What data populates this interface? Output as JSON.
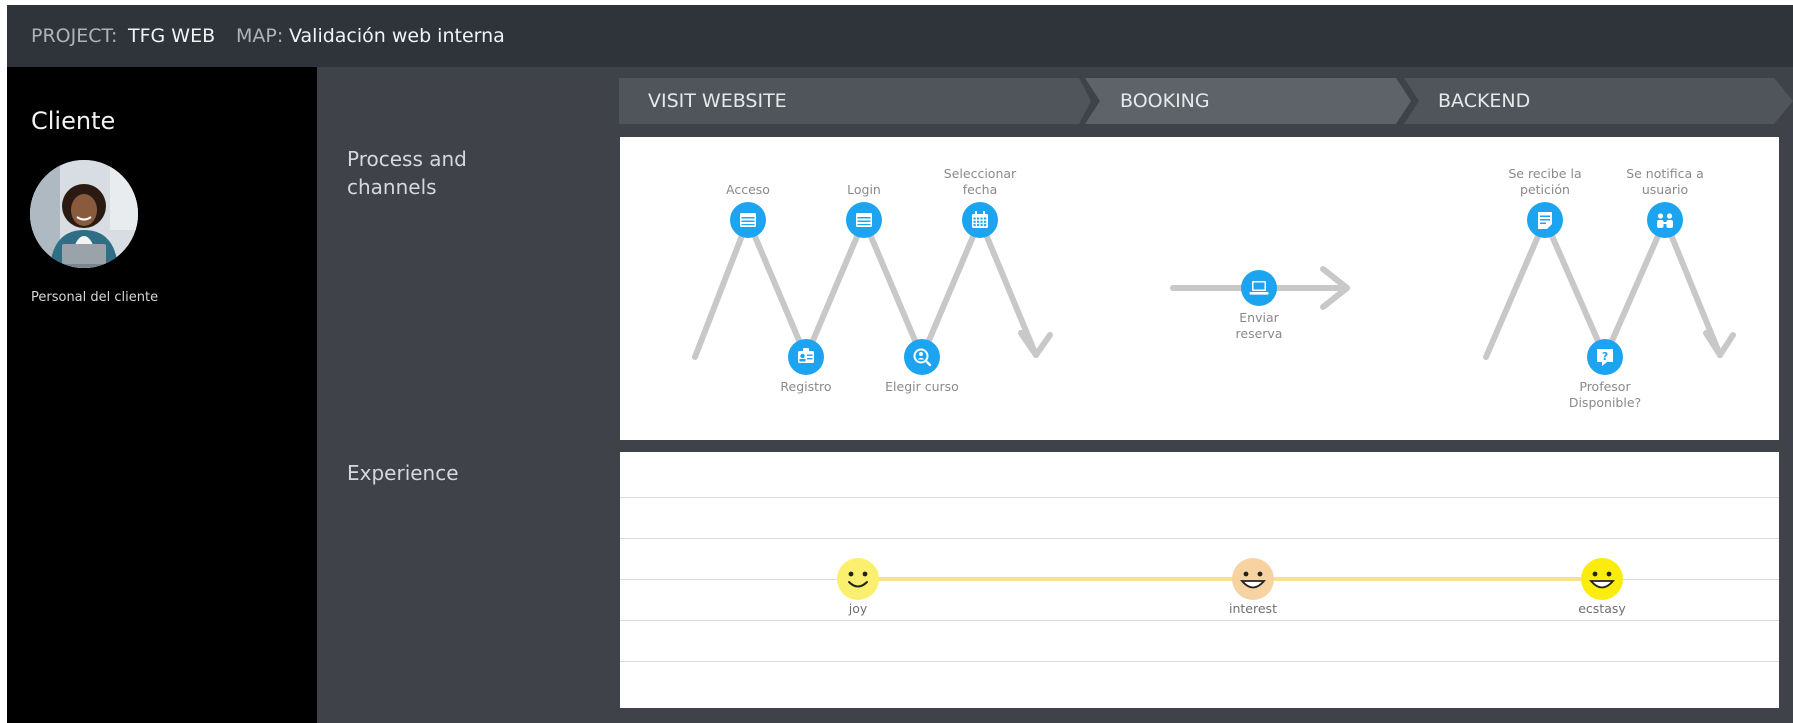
{
  "header": {
    "project_label": "PROJECT:",
    "project_name": "TFG WEB",
    "map_label": "MAP:",
    "map_name": "Validación web interna"
  },
  "persona": {
    "title": "Cliente",
    "subtitle": "Personal del cliente"
  },
  "rows": {
    "process": "Process and channels",
    "experience": "Experience"
  },
  "stages": [
    {
      "label": "VISIT WEBSITE"
    },
    {
      "label": "BOOKING"
    },
    {
      "label": "BACKEND"
    }
  ],
  "process": {
    "steps": [
      {
        "label": [
          "Acceso"
        ],
        "icon": "browser-window-icon"
      },
      {
        "label": [
          "Registro"
        ],
        "icon": "id-card-icon"
      },
      {
        "label": [
          "Login"
        ],
        "icon": "browser-window-icon"
      },
      {
        "label": [
          "Elegir curso"
        ],
        "icon": "search-user-icon"
      },
      {
        "label": [
          "Seleccionar",
          "fecha"
        ],
        "icon": "calendar-icon"
      },
      {
        "label": [
          "Enviar",
          "reserva"
        ],
        "icon": "laptop-icon"
      },
      {
        "label": [
          "Se recibe la",
          "petición"
        ],
        "icon": "document-icon"
      },
      {
        "label": [
          "Profesor",
          "Disponible?"
        ],
        "icon": "question-icon"
      },
      {
        "label": [
          "Se notifica a",
          "usuario"
        ],
        "icon": "users-icon"
      }
    ],
    "accent": "#1ca4f0"
  },
  "experience": {
    "points": [
      {
        "label": "joy",
        "emotion": "joy",
        "color": "#fbf06e"
      },
      {
        "label": "interest",
        "emotion": "interest",
        "color": "#f6d3a0"
      },
      {
        "label": "ecstasy",
        "emotion": "ecstasy",
        "color": "#faed0c"
      }
    ],
    "line_color": "#fbe18a"
  }
}
